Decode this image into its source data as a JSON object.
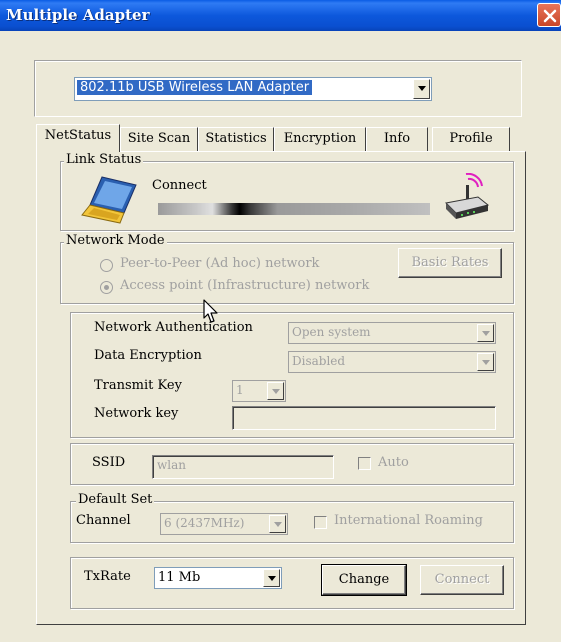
{
  "window": {
    "title": "Multiple Adapter"
  },
  "adapter": {
    "selected": "802.11b USB Wireless LAN Adapter"
  },
  "tabs": [
    {
      "label": "NetStatus",
      "active": true
    },
    {
      "label": "Site Scan"
    },
    {
      "label": "Statistics"
    },
    {
      "label": "Encryption"
    },
    {
      "label": "Info"
    },
    {
      "label": "Profile"
    }
  ],
  "link_status": {
    "legend": "Link Status",
    "status_text": "Connect",
    "signal_fraction": 0.3
  },
  "network_mode": {
    "legend": "Network Mode",
    "adhoc_label": "Peer-to-Peer (Ad hoc) network",
    "infra_label": "Access point (Infrastructure) network",
    "selected": "infrastructure",
    "basic_rates_label": "Basic Rates"
  },
  "security": {
    "auth_label": "Network Authentication",
    "auth_value": "Open system",
    "encryption_label": "Data Encryption",
    "encryption_value": "Disabled",
    "transmit_key_label": "Transmit Key",
    "transmit_key_value": "1",
    "network_key_label": "Network key",
    "network_key_value": ""
  },
  "ssid": {
    "label": "SSID",
    "value": "wlan",
    "auto_label": "Auto",
    "auto_checked": false
  },
  "default_set": {
    "legend": "Default Set",
    "channel_label": "Channel",
    "channel_value": "6  (2437MHz)",
    "roaming_label": "International Roaming",
    "roaming_checked": false
  },
  "txrate": {
    "label": "TxRate",
    "value": "11 Mb",
    "change_label": "Change",
    "connect_label": "Connect"
  },
  "colors": {
    "titlebar": "#0a5ce4",
    "close_button": "#d9583b",
    "selection": "#316ac5",
    "dialog_bg": "#ece9d8",
    "disabled_text": "#a0a0a0"
  }
}
